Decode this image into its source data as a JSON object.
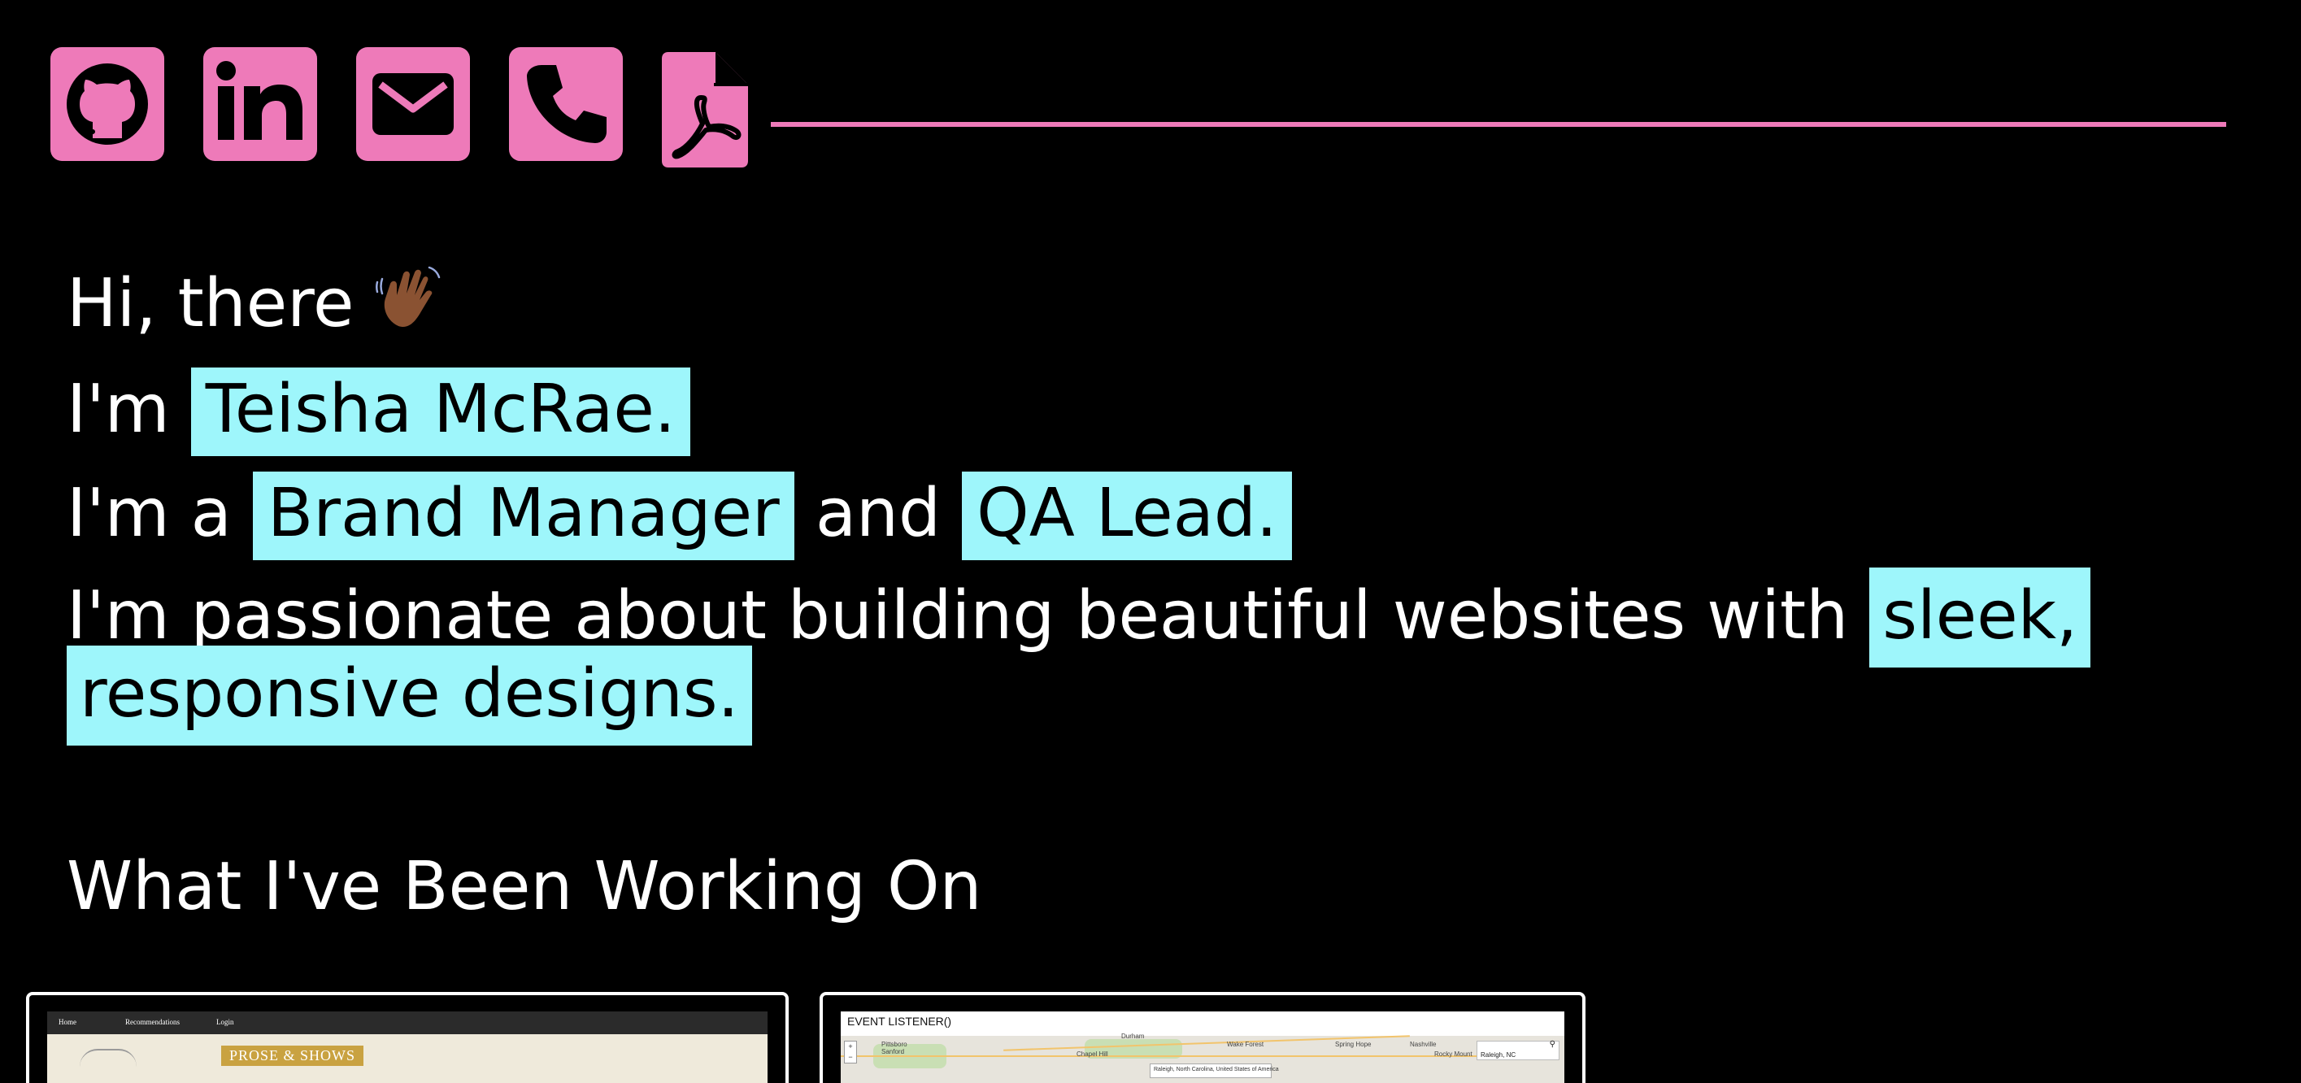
{
  "colors": {
    "accent_pink": "#ee7ab9",
    "highlight_cyan": "#9ef6fb",
    "background": "#000000",
    "text": "#ffffff"
  },
  "social_links": [
    {
      "name": "GitHub",
      "icon": "github-icon"
    },
    {
      "name": "LinkedIn",
      "icon": "linkedin-icon"
    },
    {
      "name": "Email",
      "icon": "envelope-icon"
    },
    {
      "name": "Phone",
      "icon": "phone-icon"
    },
    {
      "name": "Resume PDF",
      "icon": "pdf-icon"
    }
  ],
  "intro": {
    "greeting": "Hi, there",
    "greeting_emoji": "waving-hand-icon",
    "name_prefix": "I'm",
    "name": "Teisha McRae.",
    "role_prefix": "I'm a",
    "role_1": "Brand Manager",
    "role_joiner": "and",
    "role_2": "QA Lead.",
    "passion_prefix": "I'm passionate about building beautiful websites with",
    "passion_highlight_1": "sleek,",
    "passion_highlight_2": "responsive designs."
  },
  "projects": {
    "heading": "What I've Been Working On",
    "cards": [
      {
        "nav": [
          "Home",
          "Recommendations",
          "Login"
        ],
        "banner": "PROSE & SHOWS"
      },
      {
        "title": "EVENT LISTENER()",
        "map_labels": [
          "Durham",
          "Wake Forest",
          "Nashville",
          "Chapel Hill",
          "Raleigh, NC",
          "Pittsboro",
          "Sanford",
          "Rocky Mount",
          "Spring Hope"
        ],
        "popup_text": "Raleigh, North Carolina, United States of America",
        "zoom_in": "+",
        "zoom_out": "−"
      }
    ]
  }
}
